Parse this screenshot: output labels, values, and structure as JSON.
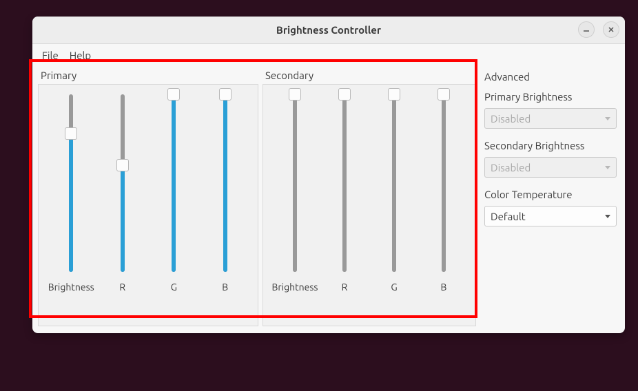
{
  "window": {
    "title": "Brightness Controller"
  },
  "menu": {
    "file": "File",
    "help": "Help"
  },
  "primary": {
    "title": "Primary",
    "sliders": {
      "brightness": {
        "label": "Brightness",
        "value": 78
      },
      "r": {
        "label": "R",
        "value": 60
      },
      "g": {
        "label": "G",
        "value": 100
      },
      "b": {
        "label": "B",
        "value": 100
      }
    }
  },
  "secondary": {
    "title": "Secondary",
    "sliders": {
      "brightness": {
        "label": "Brightness",
        "value": 100
      },
      "r": {
        "label": "R",
        "value": 100
      },
      "g": {
        "label": "G",
        "value": 100
      },
      "b": {
        "label": "B",
        "value": 100
      }
    }
  },
  "advanced": {
    "title": "Advanced",
    "primary_brightness_label": "Primary Brightness",
    "primary_brightness_value": "Disabled",
    "secondary_brightness_label": "Secondary Brightness",
    "secondary_brightness_value": "Disabled",
    "color_temp_label": "Color Temperature",
    "color_temp_value": "Default"
  }
}
